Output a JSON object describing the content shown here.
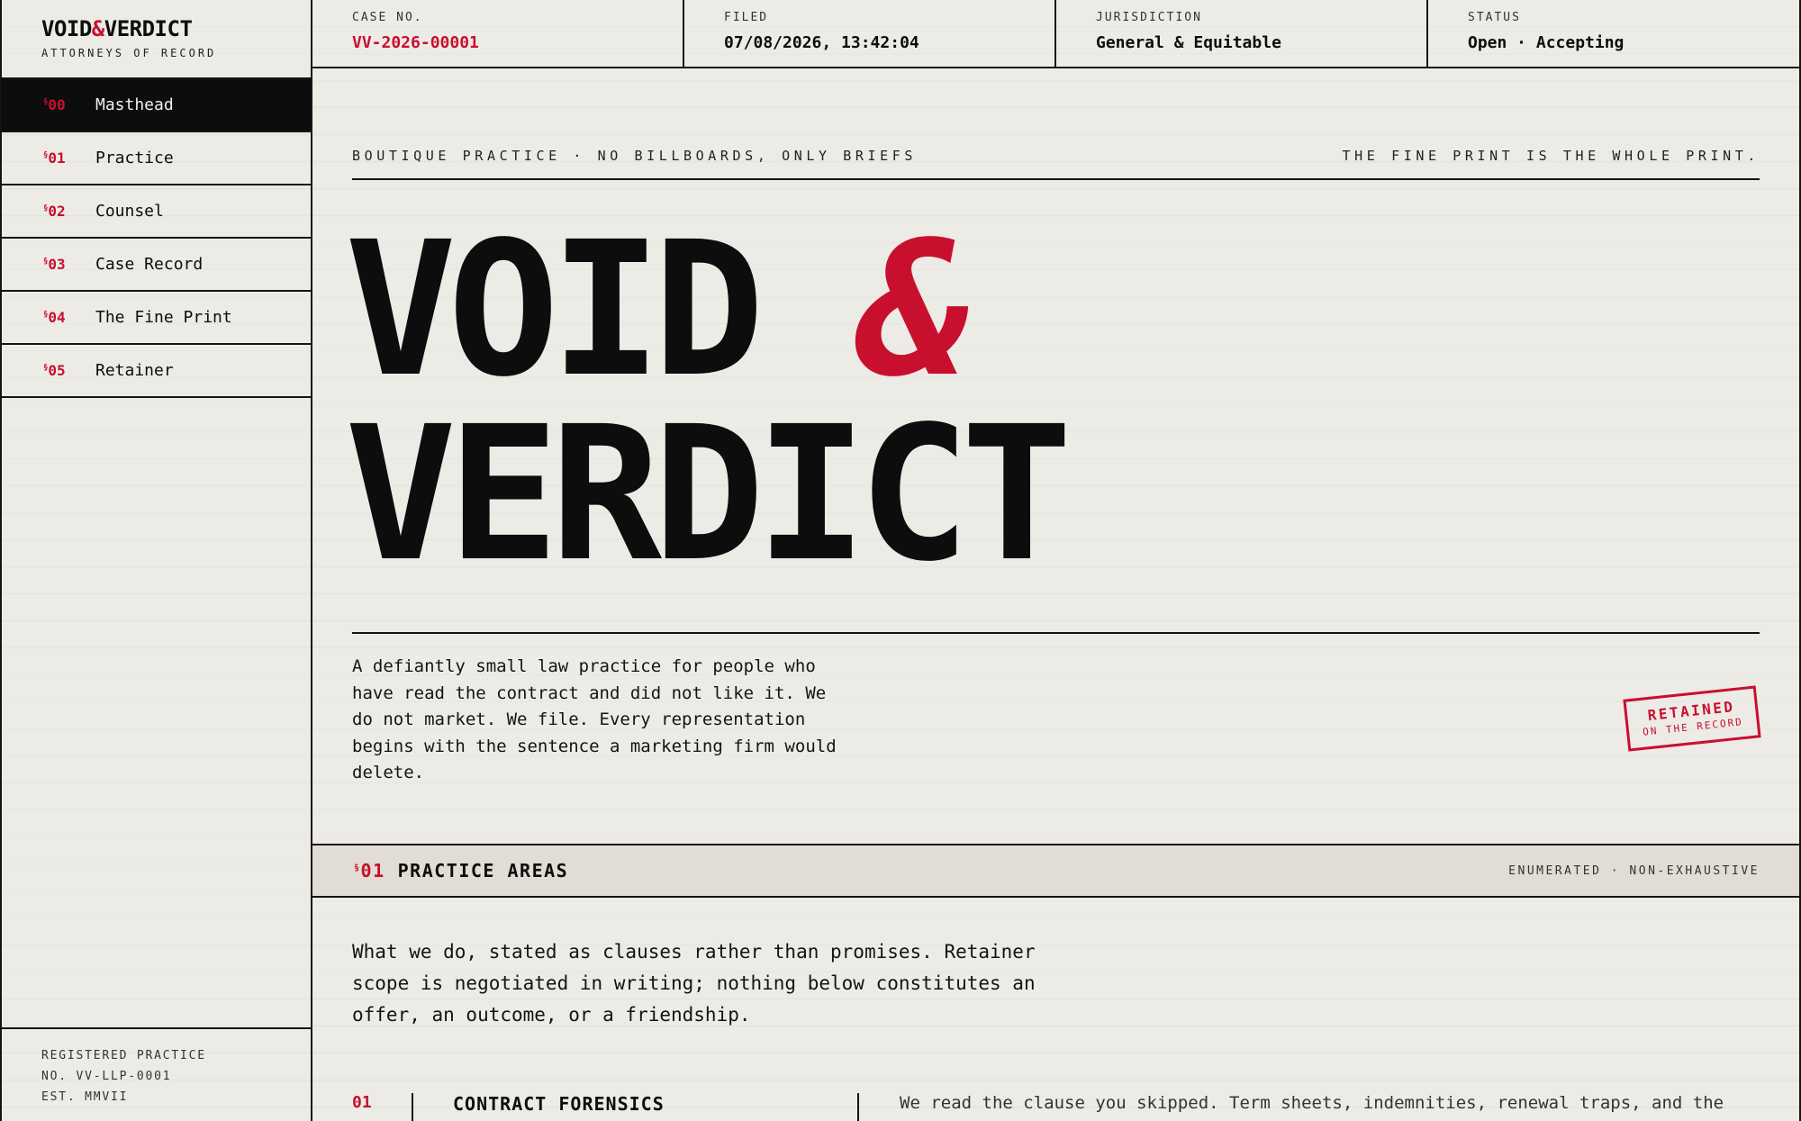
{
  "sidebar": {
    "brand_prefix": "VOID",
    "brand_amp": "&",
    "brand_suffix": "VERDICT",
    "brand_sub": "ATTORNEYS OF RECORD",
    "items": [
      {
        "num": "00",
        "label": "Masthead",
        "active": true
      },
      {
        "num": "01",
        "label": "Practice"
      },
      {
        "num": "02",
        "label": "Counsel"
      },
      {
        "num": "03",
        "label": "Case Record"
      },
      {
        "num": "04",
        "label": "The Fine Print"
      },
      {
        "num": "05",
        "label": "Retainer"
      }
    ],
    "section_mark": "§",
    "footer": [
      "REGISTERED PRACTICE",
      "NO. VV-LLP-0001",
      "EST. MMVII"
    ]
  },
  "topbar": {
    "case_label": "CASE NO.",
    "case_value": "VV-2026-00001",
    "filed_label": "FILED",
    "filed_value": "07/08/2026, 13:42:04",
    "jurisdiction_label": "JURISDICTION",
    "jurisdiction_value": "General & Equitable",
    "status_label": "STATUS",
    "status_value": "Open · Accepting"
  },
  "main": {
    "strap_left": "BOUTIQUE PRACTICE · NO BILLBOARDS, ONLY BRIEFS",
    "strap_right": "THE FINE PRINT IS THE WHOLE PRINT.",
    "hero_line1": "VOID",
    "hero_amp": "&",
    "hero_line2": "VERDICT",
    "lede": "A defiantly small law practice for people who have read the contract and did not like it. We do not market. We file. Every representation begins with the sentence a marketing firm would delete.",
    "stamp_main": "RETAINED",
    "stamp_sub": "ON THE RECORD",
    "section": {
      "mark": "§",
      "num": "01",
      "title": "PRACTICE AREAS",
      "note": "ENUMERATED · NON-EXHAUSTIVE"
    },
    "intro": "What we do, stated as clauses rather than promises. Retainer scope is negotiated in writing; nothing below constitutes an offer, an outcome, or a friendship.",
    "first_row": {
      "num": "01",
      "title": "CONTRACT FORENSICS",
      "desc": "We read the clause you skipped. Term sheets, indemnities, renewal traps, and the"
    }
  },
  "colors": {
    "accent": "#c8102e",
    "ink": "#0d0d0d",
    "paper": "#edebe6",
    "band": "#e2ddd4"
  }
}
